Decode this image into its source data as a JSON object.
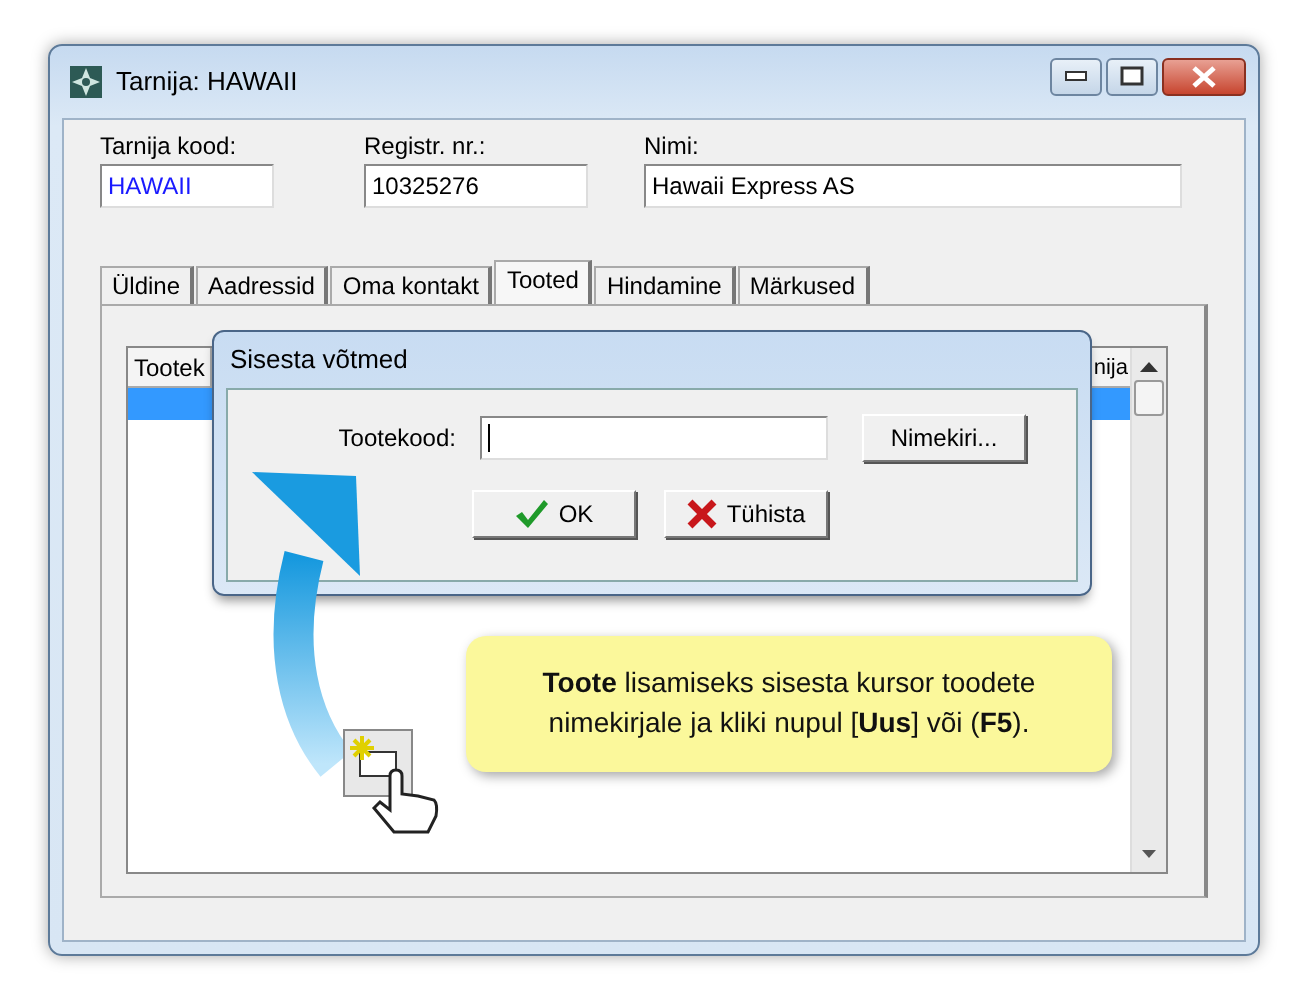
{
  "window": {
    "title": "Tarnija: HAWAII"
  },
  "fields": [
    {
      "label": "Tarnija kood:",
      "value": "HAWAII",
      "kind": "code"
    },
    {
      "label": "Registr. nr.:",
      "value": "10325276",
      "kind": "plain"
    },
    {
      "label": "Nimi:",
      "value": "Hawaii Express AS",
      "kind": "plain"
    }
  ],
  "tabs": [
    {
      "label": "Üldine",
      "selected": false
    },
    {
      "label": "Aadressid",
      "selected": false
    },
    {
      "label": "Oma kontakt",
      "selected": false
    },
    {
      "label": "Tooted",
      "selected": true
    },
    {
      "label": "Hindamine",
      "selected": false
    },
    {
      "label": "Märkused",
      "selected": false
    }
  ],
  "table": {
    "columns": [
      "Tootek",
      "nija"
    ],
    "rows": [
      {
        "selected": true
      }
    ]
  },
  "dialog": {
    "title": "Sisesta võtmed",
    "field_label": "Tootekood:",
    "list_button": "Nimekiri...",
    "ok_button": "OK",
    "cancel_button": "Tühista"
  },
  "callout": {
    "text": "**Toote** lisamiseks sisesta kursor toodete nimekirjale ja kliki nupul [**Uus**] või (**F5**)."
  }
}
